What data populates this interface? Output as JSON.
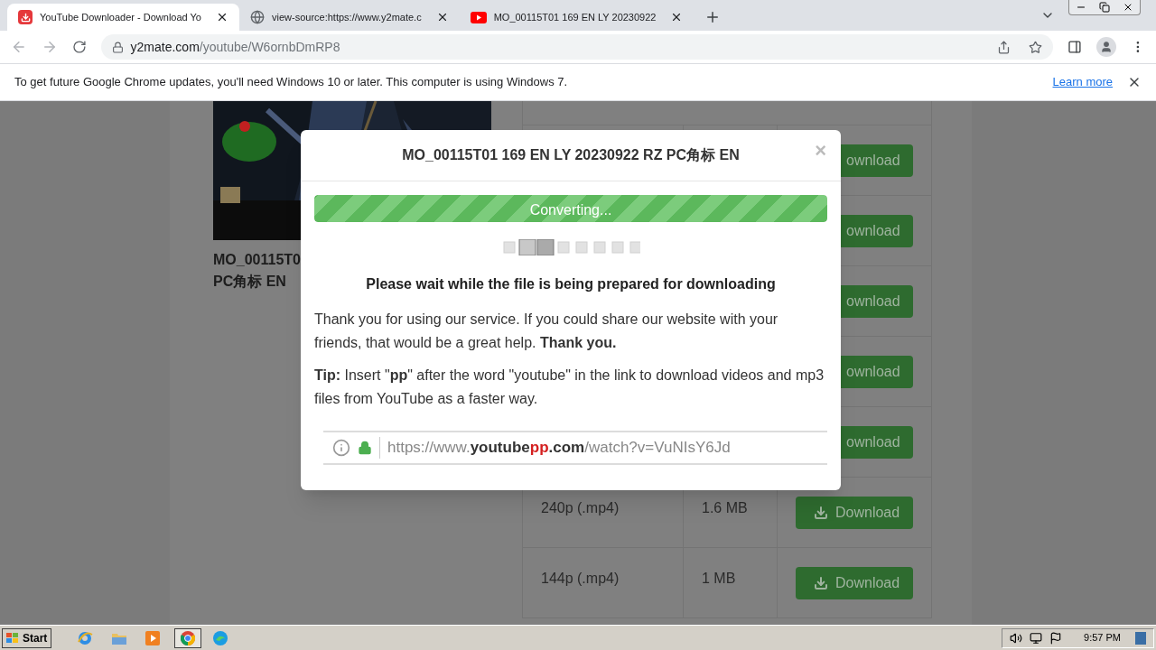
{
  "browser": {
    "tabs": [
      {
        "title": "YouTube Downloader - Download Yo",
        "kind": "download",
        "selected": true
      },
      {
        "title": "view-source:https://www.y2mate.c",
        "kind": "globe",
        "selected": false
      },
      {
        "title": "MO_00115T01 169 EN LY 20230922",
        "kind": "youtube",
        "selected": false
      }
    ],
    "address": {
      "host": "y2mate.com",
      "path": "/youtube/W6ornbDmRP8"
    },
    "infobar": {
      "message": "To get future Google Chrome updates, you'll need Windows 10 or later. This computer is using Windows 7.",
      "link": "Learn more"
    }
  },
  "page": {
    "video_title": [
      "MO_00115T0",
      "PC角标 EN"
    ],
    "rows": [
      {
        "button": {
          "label": "ownload",
          "kind": "partial"
        }
      },
      {
        "button": {
          "label": "ownload",
          "kind": "partial"
        }
      },
      {
        "button": {
          "label": "ownload",
          "kind": "partial"
        }
      },
      {
        "button": {
          "label": "ownload",
          "kind": "partial"
        }
      },
      {
        "button": {
          "label": "ownload",
          "kind": "partial"
        }
      },
      {
        "file_type": "240p (.mp4)",
        "file_size": "1.6 MB",
        "button": {
          "label": "Download",
          "kind": "full"
        }
      },
      {
        "file_type": "144p (.mp4)",
        "file_size": "1 MB",
        "button": {
          "label": "Download",
          "kind": "full"
        }
      }
    ]
  },
  "modal": {
    "title": "MO_00115T01 169 EN LY 20230922 RZ PC角标 EN",
    "close": "×",
    "progress": {
      "label": "Converting...",
      "level": 1
    },
    "heading": "Please wait while the file is being prepared for downloading",
    "paragraphs": [
      "Thank you for using our service. If you could share our website with your friends, that would be a great help. **Thank you.**",
      "**Tip:** Insert \"**pp**\" after the word \"youtube\" in the link to download videos and mp3 files from YouTube as a faster way."
    ],
    "example_url": [
      {
        "text": "https://www.",
        "kind": "plain"
      },
      {
        "text": "youtube",
        "kind": "domain"
      },
      {
        "text": "pp",
        "kind": "highlight"
      },
      {
        "text": ".com",
        "kind": "domain"
      },
      {
        "text": "/watch?v=VuNIsY6Jd",
        "kind": "plain"
      }
    ]
  },
  "taskbar": {
    "start": "Start",
    "time": "9:57 PM"
  }
}
